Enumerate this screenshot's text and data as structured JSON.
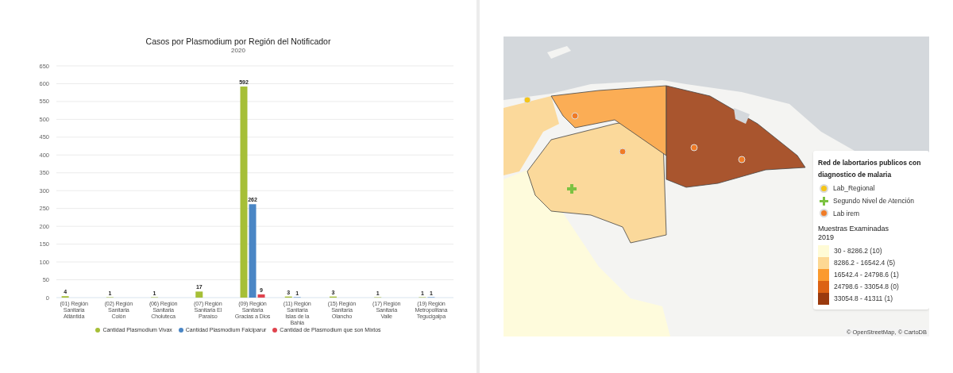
{
  "chart": {
    "subtitle": "2020",
    "chart_data": {
      "type": "bar",
      "title": "Casos por Plasmodium por Región del Notificador",
      "categories": [
        "(01) Región Sanitaria Atlántida",
        "(02) Región Sanitaria Colón",
        "(06) Región Sanitaria Choluteca",
        "(07) Región Sanitaria El Paraíso",
        "(09) Región Sanitaria Gracias a Dios",
        "(11) Región Sanitaria Islas de la Bahia",
        "(15) Región Sanitaria Olancho",
        "(17) Región Sanitaria Valle",
        "(19) Región Metropolitana Tegucigalpa"
      ],
      "series": [
        {
          "name": "Cantidad Plasmodium Vivax",
          "color": "#a6bf37",
          "values": [
            4,
            1,
            1,
            17,
            592,
            3,
            3,
            1,
            1
          ]
        },
        {
          "name": "Cantidad Plasmodium Falciparur",
          "color": "#4a86c5",
          "values": [
            null,
            null,
            null,
            null,
            262,
            1,
            null,
            null,
            1
          ]
        },
        {
          "name": "Cantidad de Plasmodium que son Mixtos",
          "color": "#e0444e",
          "values": [
            null,
            null,
            null,
            null,
            9,
            null,
            null,
            null,
            null
          ]
        }
      ],
      "ylim": [
        0,
        650
      ],
      "yticks": [
        0,
        50,
        100,
        150,
        200,
        250,
        300,
        350,
        400,
        450,
        500,
        550,
        600,
        650
      ],
      "data_labels": true,
      "grid": true
    }
  },
  "map": {
    "kind": "picture",
    "legend": {
      "title": "Red de labortarios publicos con diagnostico de malaria",
      "markers": [
        {
          "kind": "circle",
          "color": "#f5c518",
          "label": "Lab_Regional"
        },
        {
          "kind": "cross",
          "color": "#7cc242",
          "label": "Segundo Nivel de Atención"
        },
        {
          "kind": "circle",
          "color": "#f07b26",
          "label": "Lab irem"
        }
      ],
      "scale_title": "Muestras Examinadas",
      "scale_year": "2019",
      "classes": [
        {
          "color": "#fffbd6",
          "label": "30 - 8286.2 (10)"
        },
        {
          "color": "#fdd893",
          "label": "8286.2 - 16542.4 (5)"
        },
        {
          "color": "#fb9a2e",
          "label": "16542.4 - 24798.6 (1)"
        },
        {
          "color": "#dc6214",
          "label": "24798.6 - 33054.8 (0)"
        },
        {
          "color": "#9a3a0e",
          "label": "33054.8 - 41311 (1)"
        }
      ]
    },
    "attribution": "© OpenStreetMap, © CartoDB"
  }
}
